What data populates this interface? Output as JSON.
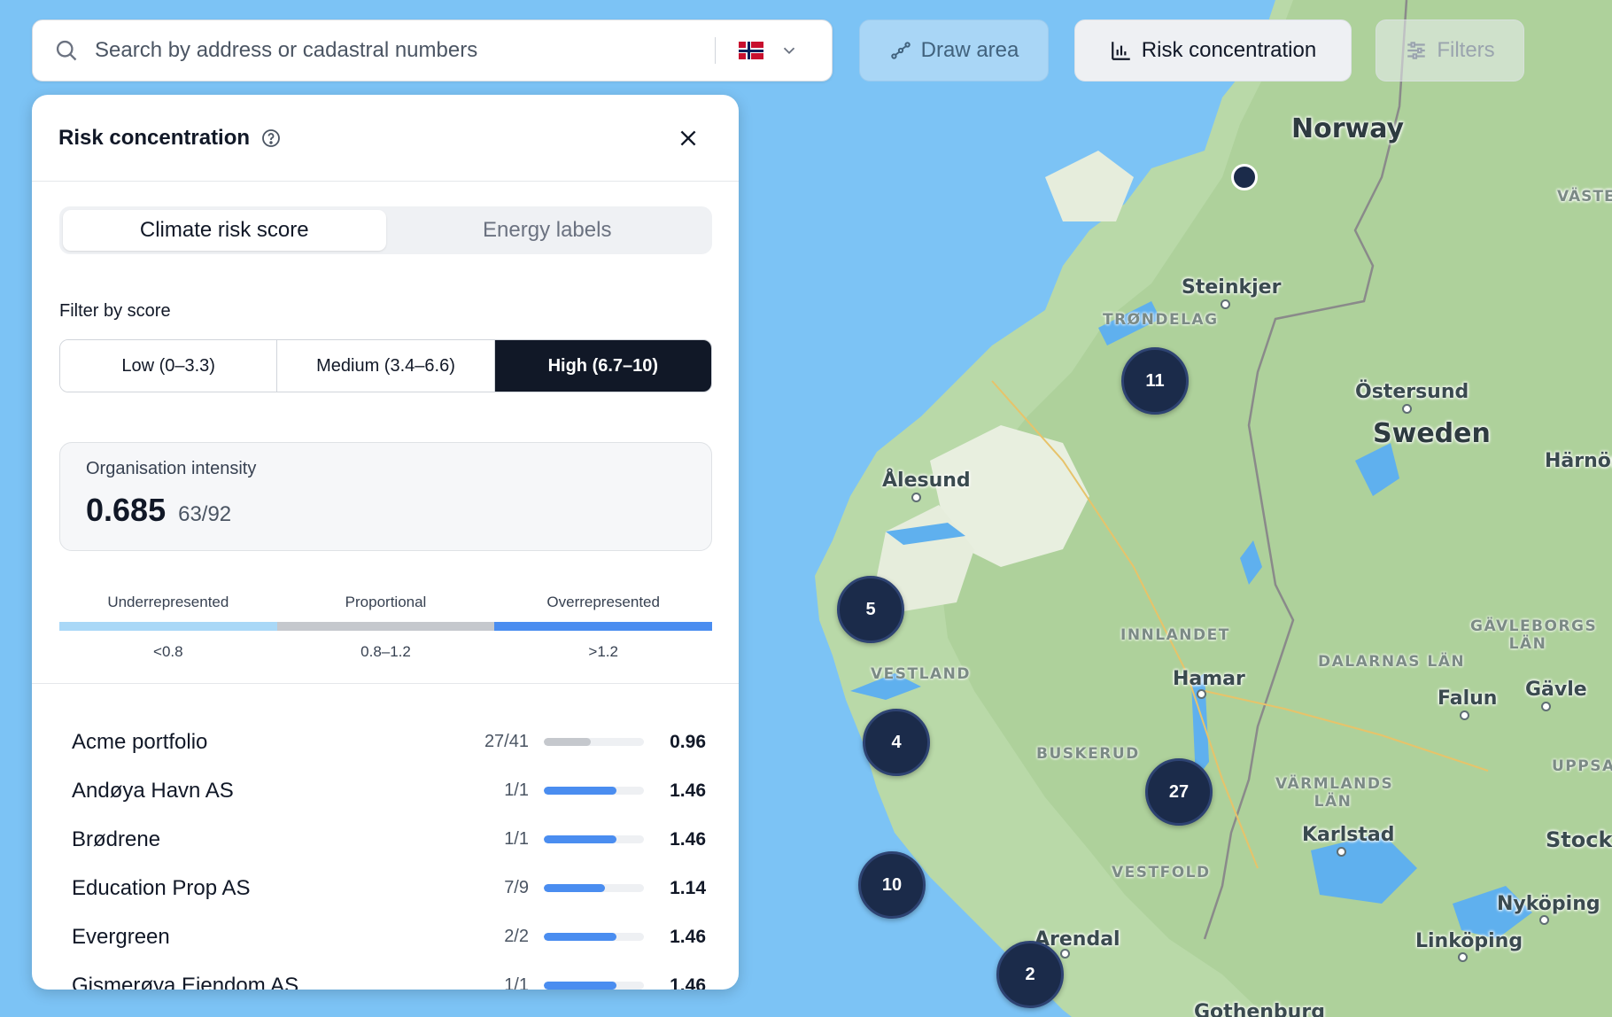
{
  "search": {
    "placeholder": "Search by address or cadastral numbers",
    "country": "Norway"
  },
  "toolbar": {
    "draw_area": "Draw area",
    "risk_concentration": "Risk concentration",
    "filters": "Filters"
  },
  "panel": {
    "title": "Risk concentration",
    "tabs": [
      {
        "label": "Climate risk score",
        "active": true
      },
      {
        "label": "Energy labels",
        "active": false
      }
    ],
    "filter_label": "Filter by score",
    "score_filters": [
      {
        "label": "Low (0–3.3)",
        "selected": false
      },
      {
        "label": "Medium (3.4–6.6)",
        "selected": false
      },
      {
        "label": "High (6.7–10)",
        "selected": true
      }
    ],
    "intensity": {
      "label": "Organisation intensity",
      "value": "0.685",
      "ratio": "63/92"
    },
    "legend": [
      {
        "label": "Underrepresented",
        "range": "<0.8",
        "color": "#a9d8f7"
      },
      {
        "label": "Proportional",
        "range": "0.8–1.2",
        "color": "#c5c8cd"
      },
      {
        "label": "Overrepresented",
        "range": ">1.2",
        "color": "#4a8df0"
      }
    ],
    "organisations": [
      {
        "name": "Acme portfolio",
        "ratio": "27/41",
        "score": "0.96",
        "fill": 0.47,
        "color": "#c5c8cd"
      },
      {
        "name": "Andøya Havn AS",
        "ratio": "1/1",
        "score": "1.46",
        "fill": 0.73,
        "color": "#4a8df0"
      },
      {
        "name": "Brødrene",
        "ratio": "1/1",
        "score": "1.46",
        "fill": 0.73,
        "color": "#4a8df0"
      },
      {
        "name": "Education Prop AS",
        "ratio": "7/9",
        "score": "1.14",
        "fill": 0.61,
        "color": "#4a8df0"
      },
      {
        "name": "Evergreen",
        "ratio": "2/2",
        "score": "1.46",
        "fill": 0.73,
        "color": "#4a8df0"
      },
      {
        "name": "Gismerøya Eiendom AS",
        "ratio": "1/1",
        "score": "1.46",
        "fill": 0.73,
        "color": "#4a8df0"
      }
    ]
  },
  "map": {
    "countries": [
      "Norway",
      "Sweden"
    ],
    "cities": [
      "Steinkjer",
      "Östersund",
      "Ålesund",
      "Hamar",
      "Falun",
      "Gävle",
      "Karlstad",
      "Arendal",
      "Nyköping",
      "Linköping",
      "Gothenburg",
      "Stock",
      "Härnös",
      "VÄSTE"
    ],
    "regions": [
      "TRØNDELAG",
      "INNLANDET",
      "VESTLAND",
      "BUSKERUD",
      "VESTFOLD",
      "DALARNAS LÄN",
      "GÄVLEBORGS LÄN",
      "VÄRMLANDS LÄN",
      "UPPSALA L"
    ],
    "clusters": [
      "11",
      "5",
      "4",
      "27",
      "10",
      "2"
    ]
  }
}
